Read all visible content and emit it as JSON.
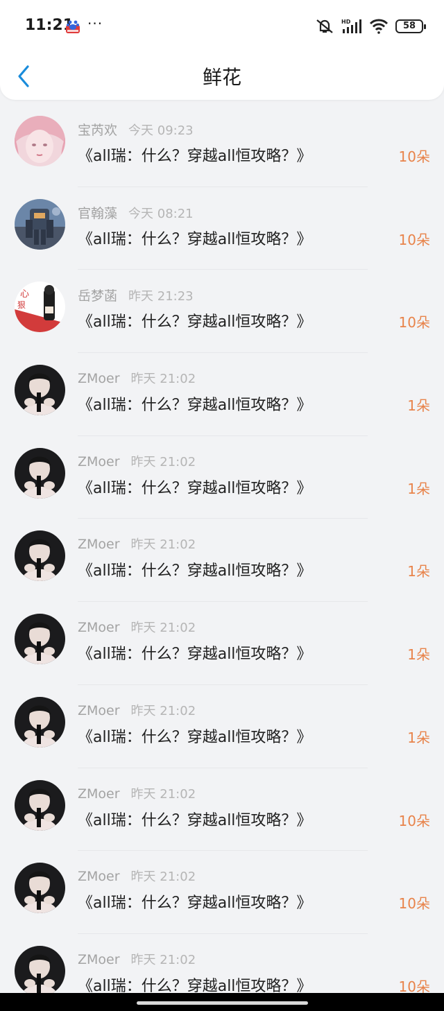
{
  "status_bar": {
    "time": "11:21",
    "battery": "58",
    "icons": [
      "baidu-app-icon",
      "more-dots-icon",
      "vibrate-off-icon",
      "hd-signal-icon",
      "wifi-icon",
      "battery-icon"
    ],
    "dots": "···"
  },
  "header": {
    "title": "鲜花",
    "back_icon": "chevron-left-icon",
    "accent": "#1a8cdb"
  },
  "colors": {
    "count": "#e8834a",
    "name": "#a3a3a3",
    "background": "#f2f3f5"
  },
  "items": [
    {
      "name": "宝芮欢",
      "date": "今天 09:23",
      "book": "《all瑞：什么？穿越all恒攻略？》",
      "count": "10朵",
      "avatar": "avatar-pink-hair"
    },
    {
      "name": "官翰藻",
      "date": "今天 08:21",
      "book": "《all瑞：什么？穿越all恒攻略？》",
      "count": "10朵",
      "avatar": "avatar-mecha"
    },
    {
      "name": "岳梦菡",
      "date": "昨天 21:23",
      "book": "《all瑞：什么？穿越all恒攻略？》",
      "count": "10朵",
      "avatar": "avatar-poster"
    },
    {
      "name": "ZMoer",
      "date": "昨天 21:02",
      "book": "《all瑞：什么？穿越all恒攻略？》",
      "count": "1朵",
      "avatar": "avatar-boy"
    },
    {
      "name": "ZMoer",
      "date": "昨天 21:02",
      "book": "《all瑞：什么？穿越all恒攻略？》",
      "count": "1朵",
      "avatar": "avatar-boy"
    },
    {
      "name": "ZMoer",
      "date": "昨天 21:02",
      "book": "《all瑞：什么？穿越all恒攻略？》",
      "count": "1朵",
      "avatar": "avatar-boy"
    },
    {
      "name": "ZMoer",
      "date": "昨天 21:02",
      "book": "《all瑞：什么？穿越all恒攻略？》",
      "count": "1朵",
      "avatar": "avatar-boy"
    },
    {
      "name": "ZMoer",
      "date": "昨天 21:02",
      "book": "《all瑞：什么？穿越all恒攻略？》",
      "count": "1朵",
      "avatar": "avatar-boy"
    },
    {
      "name": "ZMoer",
      "date": "昨天 21:02",
      "book": "《all瑞：什么？穿越all恒攻略？》",
      "count": "10朵",
      "avatar": "avatar-boy"
    },
    {
      "name": "ZMoer",
      "date": "昨天 21:02",
      "book": "《all瑞：什么？穿越all恒攻略？》",
      "count": "10朵",
      "avatar": "avatar-boy"
    },
    {
      "name": "ZMoer",
      "date": "昨天 21:02",
      "book": "《all瑞：什么？穿越all恒攻略？》",
      "count": "10朵",
      "avatar": "avatar-boy"
    }
  ]
}
